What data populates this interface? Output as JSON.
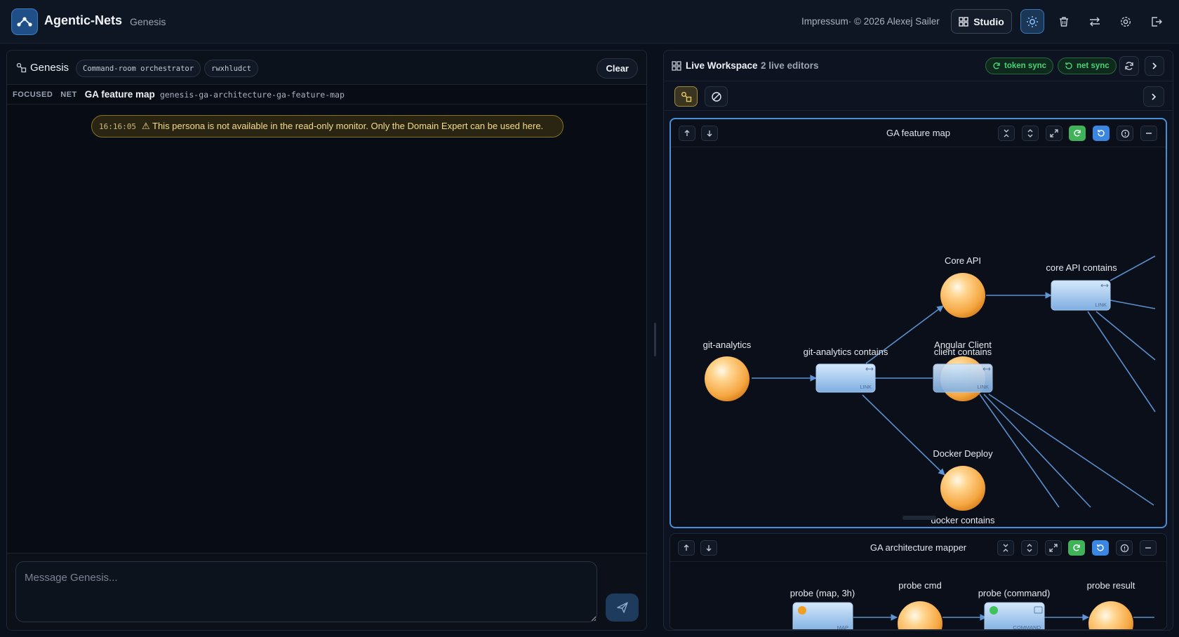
{
  "header": {
    "app_title": "Agentic-Nets",
    "app_subtitle": "Genesis",
    "impressum": "Impressum· © 2026 Alexej Sailer",
    "studio_label": "Studio"
  },
  "chat": {
    "title": "Genesis",
    "persona_badge": "Command-room orchestrator",
    "session_badge": "rwxhludct",
    "clear_label": "Clear",
    "focused_tag": "FOCUSED",
    "net_tag": "NET",
    "focused_net_name": "GA feature map",
    "focused_net_id": "genesis-ga-architecture-ga-feature-map",
    "warning_time": "16:16:05",
    "warning_text": "⚠ This persona is not available in the read-only monitor. Only the Domain Expert can be used here.",
    "input_placeholder": "Message Genesis..."
  },
  "workspace": {
    "title": "Live Workspace",
    "editors": "2 live editors",
    "token_sync": "token sync",
    "net_sync": "net sync"
  },
  "net_feature_map": {
    "title": "GA feature map",
    "places": {
      "git_analytics": "git-analytics",
      "core_api": "Core API",
      "angular_client": "Angular Client",
      "docker_deploy": "Docker Deploy"
    },
    "transitions": {
      "git_analytics_contains": "git-analytics contains",
      "core_api_contains": "core API contains",
      "client_contains": "client contains",
      "docker_contains": "docker contains"
    },
    "link_label": "LINK"
  },
  "net_architecture_mapper": {
    "title": "GA architecture mapper",
    "probe_map": "probe (map, 3h)",
    "probe_cmd": "probe cmd",
    "probe_command": "probe (command)",
    "probe_result": "probe result",
    "map_label": "MAP",
    "command_label": "COMMAND"
  },
  "colors": {
    "accent_blue": "#4a8fd6",
    "place_orange": "#f5a640",
    "sync_green": "#47d27a",
    "warning_yellow": "#f2dd8a"
  }
}
